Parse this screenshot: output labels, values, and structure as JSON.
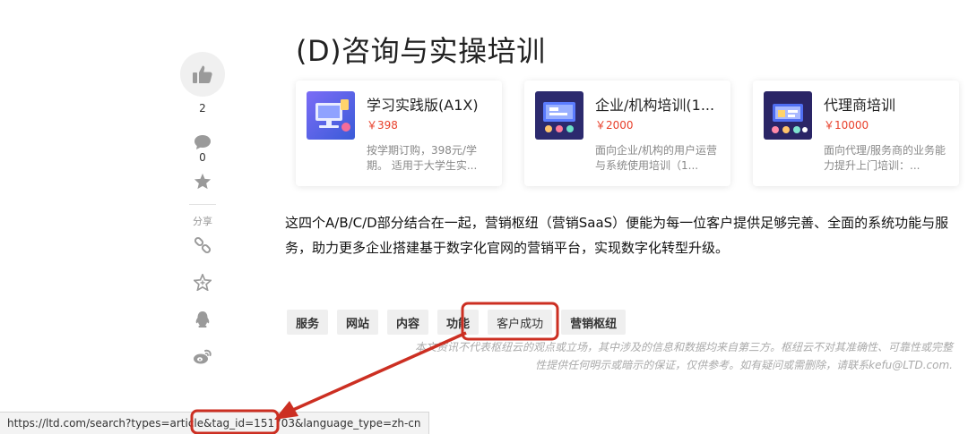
{
  "article": {
    "section_title": "(D)咨询与实操培训",
    "paragraph": "这四个A/B/C/D部分结合在一起，营销枢纽（营销SaaS）便能为每一位客户提供足够完善、全面的系统功能与服务，助力更多企业搭建基于数字化官网的营销平台，实现数字化转型升级。",
    "disclaimer": "本文资讯不代表枢纽云的观点或立场，其中涉及的信息和数据均来自第三方。枢纽云不对其准确性、可靠性或完整性提供任何明示或暗示的保证，仅供参考。如有疑问或需删除，请联系kefu@LTD.com."
  },
  "sidebar": {
    "like_count": "2",
    "comment_count": "0",
    "share_label": "分享",
    "icons": [
      "thumbs-up-icon",
      "comment-icon",
      "star-icon",
      "link-icon",
      "favorite-star-icon",
      "qq-icon",
      "weibo-icon"
    ]
  },
  "cards": [
    {
      "name": "学习实践版(A1X)",
      "price": "￥398",
      "desc": "按学期订购，398元/学期。 适用于大学生实..."
    },
    {
      "name": "企业/机构培训(1...",
      "price": "￥2000",
      "desc": "面向企业/机构的用户运营与系统使用培训（1..."
    },
    {
      "name": "代理商培训",
      "price": "￥10000",
      "desc": "面向代理/服务商的业务能力提升上门培训：..."
    }
  ],
  "tags": [
    "服务",
    "网站",
    "内容",
    "功能",
    "客户成功",
    "营销枢纽"
  ],
  "status_url": "https://ltd.com/search?types=article&tag_id=151703&language_type=zh-cn",
  "colors": {
    "price": "#e8402b",
    "annotation": "#cc2f22",
    "tag_bg": "#efefef"
  }
}
